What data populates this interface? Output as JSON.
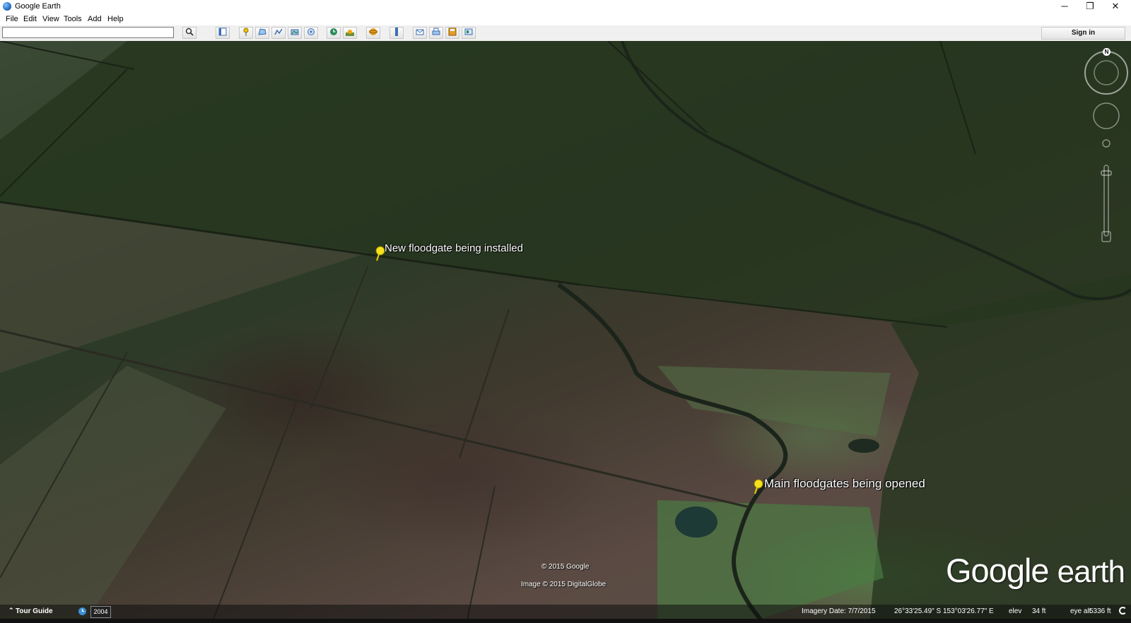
{
  "window": {
    "title": "Google Earth",
    "controls": {
      "minimize": "─",
      "restore": "❐",
      "close": "✕"
    }
  },
  "menu": {
    "items": [
      "File",
      "Edit",
      "View",
      "Tools",
      "Add",
      "Help"
    ]
  },
  "toolbar": {
    "search_value": "",
    "search_icon": "magnifier-icon",
    "buttons": [
      {
        "name": "sidebar-toggle-icon"
      },
      {
        "name": "add-placemark-icon"
      },
      {
        "name": "add-polygon-icon"
      },
      {
        "name": "add-path-icon"
      },
      {
        "name": "add-image-overlay-icon"
      },
      {
        "name": "record-tour-icon"
      },
      {
        "name": "historical-imagery-icon"
      },
      {
        "name": "sunlight-icon"
      },
      {
        "name": "switch-to-sky-icon"
      },
      {
        "name": "ruler-icon"
      },
      {
        "name": "email-icon"
      },
      {
        "name": "print-icon"
      },
      {
        "name": "save-image-icon"
      },
      {
        "name": "view-in-maps-icon"
      }
    ],
    "sign_in": "Sign in"
  },
  "map": {
    "placemarks": [
      {
        "label": "New floodgate being installed",
        "icon": "yellow-pushpin-icon"
      },
      {
        "label": "Main floodgates being opened",
        "icon": "yellow-pushpin-icon"
      }
    ],
    "compass_label": "N",
    "copyright_google": "© 2015 Google",
    "copyright_imagery": "Image © 2015 DigitalGlobe",
    "logo": {
      "google": "Google",
      "earth": "earth"
    }
  },
  "status": {
    "tour_guide": "Tour Guide",
    "year": "2004",
    "imagery_date": "Imagery Date: 7/7/2015",
    "coordinates": "26°33'25.49\" S  153°03'26.77\" E",
    "elev_label": "elev",
    "elev_value": "34 ft",
    "eye_alt_label": "eye alt",
    "eye_alt_value": "5336 ft"
  }
}
